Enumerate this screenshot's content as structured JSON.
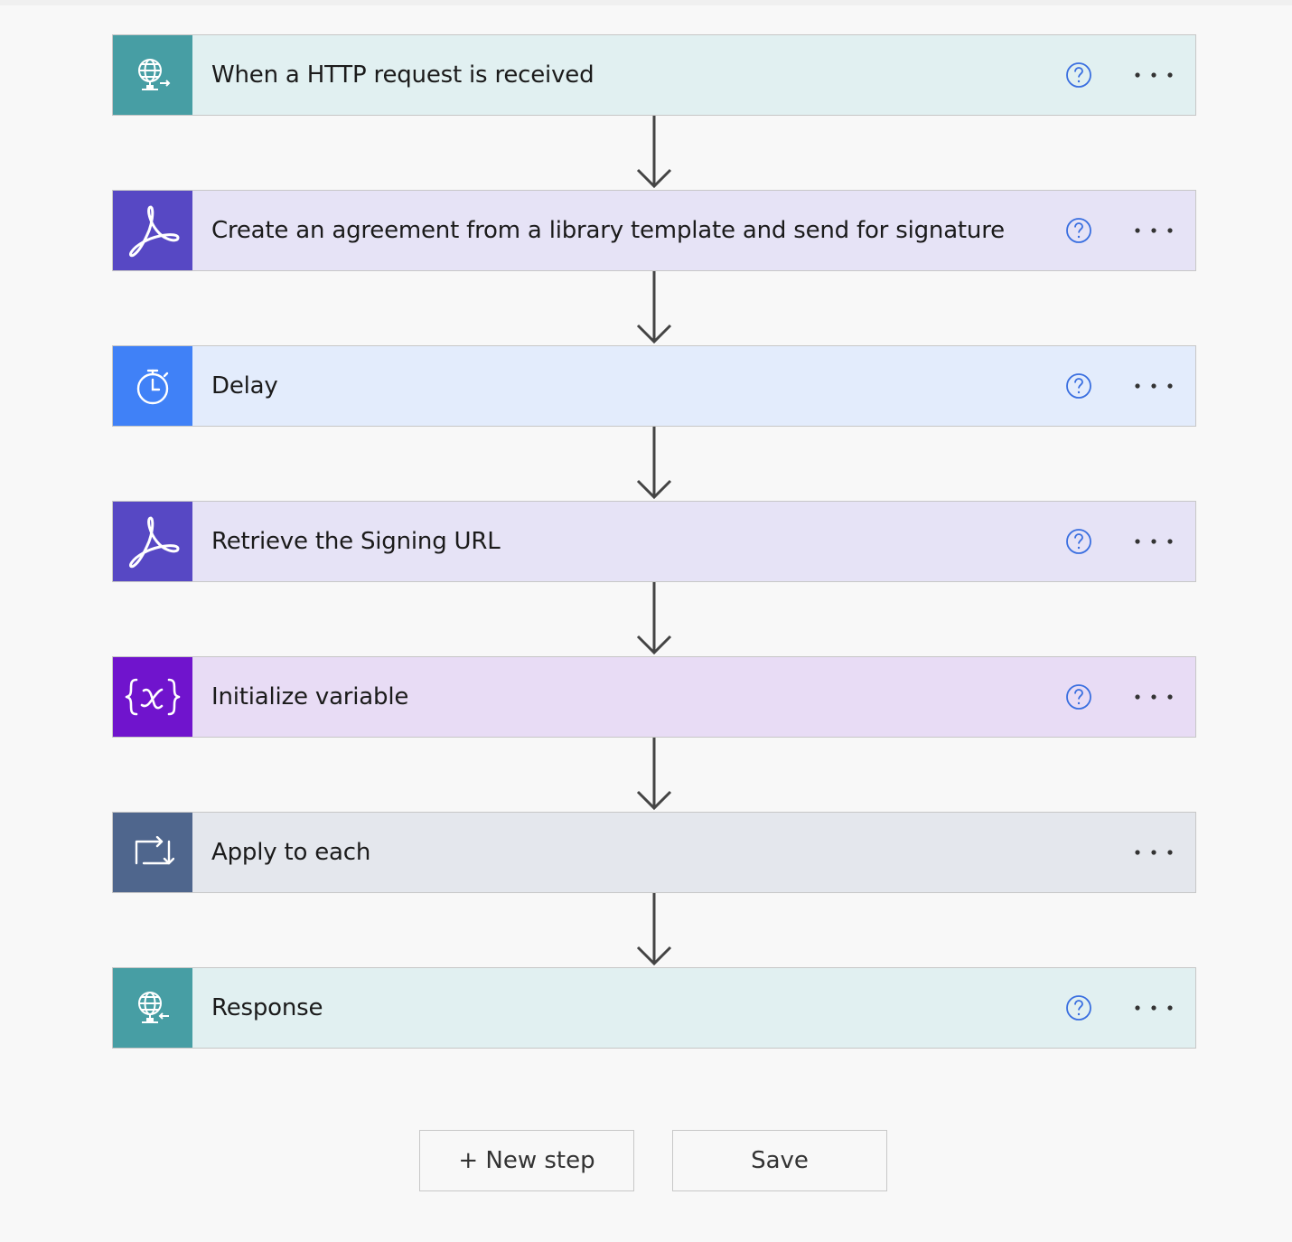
{
  "steps": [
    {
      "title": "When a HTTP request is received",
      "icon": "http-request-icon",
      "accent": "#479ea4",
      "background": "#e1f0f1",
      "has_help": true
    },
    {
      "title": "Create an agreement from a library template and send for signature",
      "icon": "adobe-sign-icon",
      "accent": "#5748c4",
      "background": "#e6e3f6",
      "has_help": true
    },
    {
      "title": "Delay",
      "icon": "timer-icon",
      "accent": "#4081f7",
      "background": "#e3ecfc",
      "has_help": true
    },
    {
      "title": "Retrieve the Signing URL",
      "icon": "adobe-sign-icon",
      "accent": "#5748c4",
      "background": "#e6e3f6",
      "has_help": true
    },
    {
      "title": "Initialize variable",
      "icon": "variable-icon",
      "accent": "#7014cd",
      "background": "#e8dcf5",
      "has_help": true
    },
    {
      "title": "Apply to each",
      "icon": "loop-icon",
      "accent": "#4f668d",
      "background": "#e4e7ed",
      "has_help": false
    },
    {
      "title": "Response",
      "icon": "http-response-icon",
      "accent": "#479ea4",
      "background": "#e1f0f1",
      "has_help": true
    }
  ],
  "actions": {
    "new_step_label": "+ New step",
    "save_label": "Save"
  },
  "colors": {
    "help": "#3a6fe0",
    "connector": "#444444",
    "border": "#c7c7c7"
  }
}
